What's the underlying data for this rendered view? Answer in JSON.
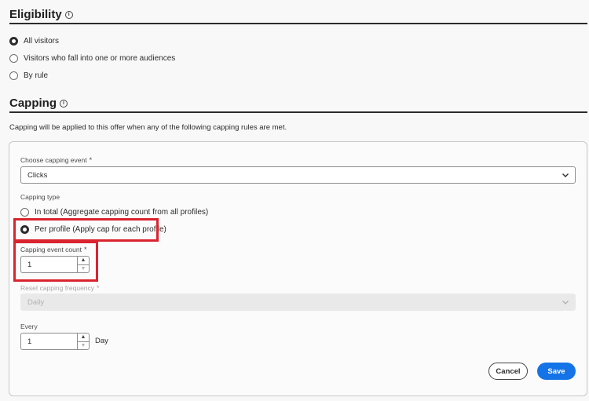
{
  "eligibility": {
    "title": "Eligibility",
    "options": [
      {
        "label": "All visitors",
        "checked": true
      },
      {
        "label": "Visitors who fall into one or more audiences",
        "checked": false
      },
      {
        "label": "By rule",
        "checked": false
      }
    ]
  },
  "capping": {
    "title": "Capping",
    "description": "Capping will be applied to this offer when any of the following capping rules are met.",
    "event_label": "Choose capping event",
    "event_value": "Clicks",
    "type_label": "Capping type",
    "type_options": [
      {
        "label": "In total (Aggregate capping count from all profiles)",
        "checked": false
      },
      {
        "label": "Per profile (Apply cap for each profile)",
        "checked": true
      }
    ],
    "count_label": "Capping event count",
    "count_value": "1",
    "reset_label": "Reset capping frequency",
    "reset_value": "Daily",
    "every_label": "Every",
    "every_value": "1",
    "every_unit": "Day",
    "required_marker": "*",
    "info_glyph": "i"
  },
  "actions": {
    "cancel": "Cancel",
    "save": "Save"
  },
  "colors": {
    "highlight": "#d9232f",
    "primary": "#1473e6"
  }
}
